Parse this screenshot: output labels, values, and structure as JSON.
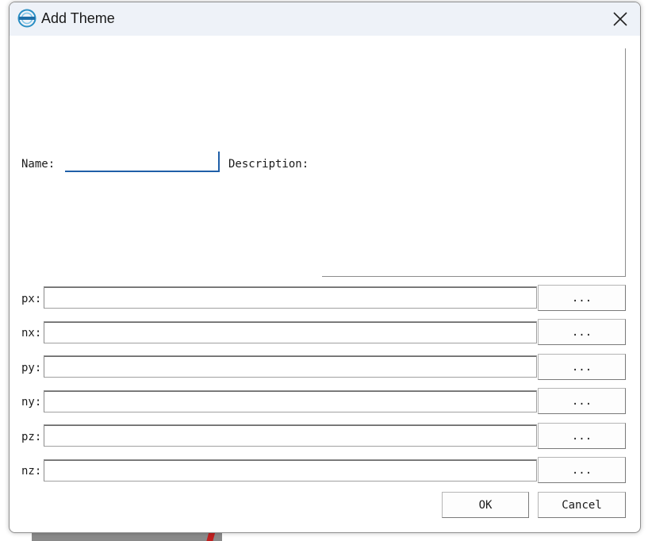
{
  "window": {
    "title": "Add Theme",
    "icon": "lidar-app-icon",
    "close_icon": "close-icon"
  },
  "form": {
    "name_label": "Name:",
    "name_value": "",
    "description_label": "Description:",
    "description_value": ""
  },
  "rows": [
    {
      "label": "px:",
      "value": "",
      "button": "..."
    },
    {
      "label": "nx:",
      "value": "",
      "button": "..."
    },
    {
      "label": "py:",
      "value": "",
      "button": "..."
    },
    {
      "label": "ny:",
      "value": "",
      "button": "..."
    },
    {
      "label": "pz:",
      "value": "",
      "button": "..."
    },
    {
      "label": "nz:",
      "value": "",
      "button": "..."
    }
  ],
  "buttons": {
    "ok": "OK",
    "cancel": "Cancel"
  },
  "colors": {
    "accent": "#1f5fa8",
    "titlebar": "#eef2f8"
  }
}
